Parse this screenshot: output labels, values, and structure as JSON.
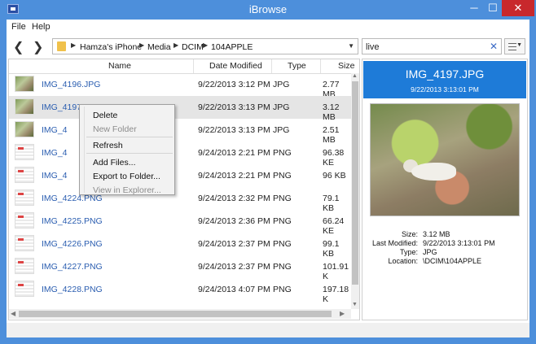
{
  "window": {
    "title": "iBrowse",
    "min": "─",
    "max": "☐",
    "close": "✕"
  },
  "menu": {
    "file": "File",
    "help": "Help"
  },
  "toolbar": {
    "back": "❮",
    "forward": "❯",
    "breadcrumbs": [
      "Hamza's iPhone",
      "Media",
      "DCIM",
      "104APPLE"
    ],
    "search_value": "live",
    "clear": "✕"
  },
  "table": {
    "columns": {
      "name": "Name",
      "date": "Date Modified",
      "type": "Type",
      "size": "Size"
    },
    "rows": [
      {
        "name": "IMG_4196.JPG",
        "date": "9/22/2013 3:12 PM",
        "type": "JPG",
        "size": "2.77 MB"
      },
      {
        "name": "IMG_4197.JPG",
        "date": "9/22/2013 3:13 PM",
        "type": "JPG",
        "size": "3.12 MB"
      },
      {
        "name": "IMG_4",
        "date": "9/22/2013 3:13 PM",
        "type": "JPG",
        "size": "2.51 MB"
      },
      {
        "name": "IMG_4",
        "date": "9/24/2013 2:21 PM",
        "type": "PNG",
        "size": "96.38 KE"
      },
      {
        "name": "IMG_4",
        "date": "9/24/2013 2:21 PM",
        "type": "PNG",
        "size": "96 KB"
      },
      {
        "name": "IMG_4224.PNG",
        "date": "9/24/2013 2:32 PM",
        "type": "PNG",
        "size": "79.1 KB"
      },
      {
        "name": "IMG_4225.PNG",
        "date": "9/24/2013 2:36 PM",
        "type": "PNG",
        "size": "66.24 KE"
      },
      {
        "name": "IMG_4226.PNG",
        "date": "9/24/2013 2:37 PM",
        "type": "PNG",
        "size": "99.1 KB"
      },
      {
        "name": "IMG_4227.PNG",
        "date": "9/24/2013 2:37 PM",
        "type": "PNG",
        "size": "101.91 K"
      },
      {
        "name": "IMG_4228.PNG",
        "date": "9/24/2013 4:07 PM",
        "type": "PNG",
        "size": "197.18 K"
      }
    ]
  },
  "context_menu": {
    "delete": "Delete",
    "new_folder": "New Folder",
    "refresh": "Refresh",
    "add_files": "Add Files...",
    "export": "Export to Folder...",
    "view_explorer": "View in Explorer..."
  },
  "preview": {
    "title": "IMG_4197.JPG",
    "date": "9/22/2013 3:13:01 PM",
    "labels": {
      "size": "Size:",
      "modified": "Last Modified:",
      "type": "Type:",
      "location": "Location:"
    },
    "values": {
      "size": "3.12 MB",
      "modified": "9/22/2013 3:13:01 PM",
      "type": "JPG",
      "location": "\\DCIM\\104APPLE"
    }
  },
  "colors": {
    "titlebar": "#4d8fdb",
    "close": "#c8282c",
    "preview_header": "#1e7bd8",
    "link_text": "#2a5db0"
  },
  "icons": [
    "app-icon",
    "back-icon",
    "forward-icon",
    "folder-icon",
    "chevron-right-icon",
    "dropdown-icon",
    "clear-icon",
    "view-options-icon"
  ]
}
